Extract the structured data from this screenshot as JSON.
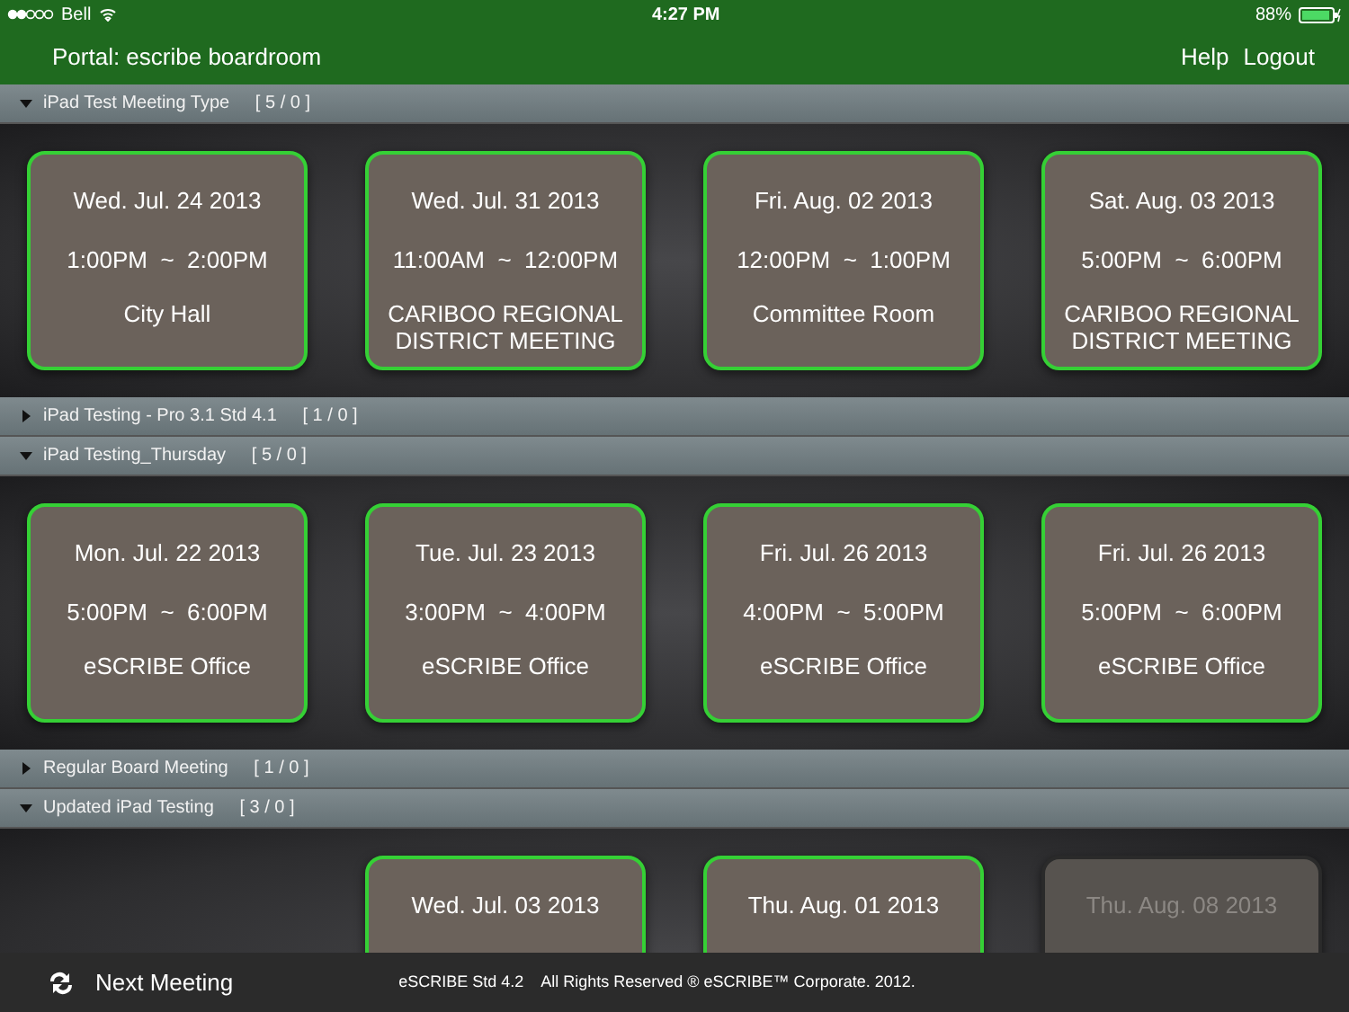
{
  "status_bar": {
    "carrier": "Bell",
    "time": "4:27 PM",
    "battery": "88%"
  },
  "header": {
    "title": "Portal: escribe boardroom",
    "links": [
      "Help",
      "Logout"
    ]
  },
  "sections": [
    {
      "title": "iPad Test Meeting Type",
      "count": "[ 5 / 0 ]",
      "expanded": true,
      "meetings": [
        {
          "date": "Wed. Jul. 24 2013",
          "start": "1:00PM",
          "sep": "~",
          "end": "2:00PM",
          "location": "City Hall",
          "disabled": false
        },
        {
          "date": "Wed. Jul. 31 2013",
          "start": "11:00AM",
          "sep": "~",
          "end": "12:00PM",
          "location": "CARIBOO REGIONAL DISTRICT MEETING",
          "disabled": false
        },
        {
          "date": "Fri. Aug. 02 2013",
          "start": "12:00PM",
          "sep": "~",
          "end": "1:00PM",
          "location": "Committee Room",
          "disabled": false
        },
        {
          "date": "Sat. Aug. 03 2013",
          "start": "5:00PM",
          "sep": "~",
          "end": "6:00PM",
          "location": "CARIBOO REGIONAL DISTRICT MEETING",
          "disabled": false
        }
      ]
    },
    {
      "title": "iPad Testing - Pro 3.1 Std 4.1",
      "count": "[ 1 / 0 ]",
      "expanded": false
    },
    {
      "title": "iPad Testing_Thursday",
      "count": "[ 5 / 0 ]",
      "expanded": true,
      "meetings": [
        {
          "date": "Mon. Jul. 22 2013",
          "start": "5:00PM",
          "sep": "~",
          "end": "6:00PM",
          "location": "eSCRIBE Office",
          "disabled": false
        },
        {
          "date": "Tue. Jul. 23 2013",
          "start": "3:00PM",
          "sep": "~",
          "end": "4:00PM",
          "location": "eSCRIBE Office",
          "disabled": false
        },
        {
          "date": "Fri. Jul. 26 2013",
          "start": "4:00PM",
          "sep": "~",
          "end": "5:00PM",
          "location": "eSCRIBE Office",
          "disabled": false
        },
        {
          "date": "Fri. Jul. 26 2013",
          "start": "5:00PM",
          "sep": "~",
          "end": "6:00PM",
          "location": "eSCRIBE Office",
          "disabled": false
        }
      ]
    },
    {
      "title": "Regular Board Meeting",
      "count": "[ 1 / 0 ]",
      "expanded": false
    },
    {
      "title": "Updated iPad Testing",
      "count": "[ 3 / 0 ]",
      "expanded": true,
      "meetings": [
        {
          "date": "Wed. Jul. 03 2013",
          "disabled": false
        },
        {
          "date": "Thu. Aug. 01 2013",
          "disabled": false
        },
        {
          "date": "Thu. Aug. 08 2013",
          "disabled": true
        }
      ]
    }
  ],
  "footer": {
    "next_meeting": "Next Meeting",
    "copyright": "eSCRIBE Std 4.2    All Rights Reserved ® eSCRIBE™ Corporate. 2012."
  }
}
